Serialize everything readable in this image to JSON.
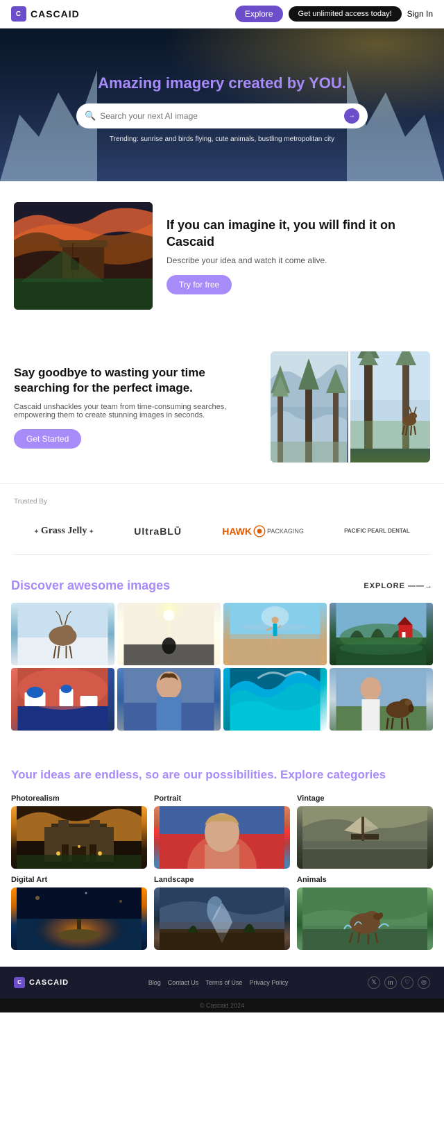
{
  "nav": {
    "logo_text": "CASCAID",
    "explore_btn": "Explore",
    "unlimited_btn": "Get unlimited access today!",
    "signin_btn": "Sign In"
  },
  "hero": {
    "title_plain": "Amazing imagery created by ",
    "title_accent": "YOU.",
    "search_placeholder": "Search your next AI image",
    "trending_label": "Trending:",
    "trending_items": "sunrise and birds flying, cute animals, bustling metropolitan city"
  },
  "section_imagine": {
    "heading": "If you can imagine it, you will find it on Cascaid",
    "description": "Describe your idea and watch it come alive.",
    "cta": "Try for free"
  },
  "section_goodbye": {
    "heading": "Say goodbye to wasting your time searching for the perfect image.",
    "description": "Cascaid unshackles your team from time-consuming searches, empowering them to create stunning images in seconds.",
    "cta": "Get Started"
  },
  "trusted": {
    "label": "Trusted By",
    "brands": [
      {
        "name": "Grass Jelly",
        "style": "script"
      },
      {
        "name": "UltraBLU",
        "style": "bold"
      },
      {
        "name": "HAWK Packaging",
        "style": "orange"
      },
      {
        "name": "Pacific Pearl Dental",
        "style": "small"
      }
    ]
  },
  "discover": {
    "title_plain": "Discover ",
    "title_accent": "awesome",
    "title_suffix": " images",
    "explore_link": "EXPLORE ——→"
  },
  "categories": {
    "title_plain": "Your ideas are endless, so are our possibilities. Explore ",
    "title_accent": "categories",
    "items": [
      {
        "label": "Photorealism",
        "key": "photorealism"
      },
      {
        "label": "Portrait",
        "key": "portrait"
      },
      {
        "label": "Vintage",
        "key": "vintage"
      },
      {
        "label": "Digital Art",
        "key": "digital-art"
      },
      {
        "label": "Landscape",
        "key": "landscape"
      },
      {
        "label": "Animals",
        "key": "animals"
      }
    ]
  },
  "footer": {
    "logo": "CASCAID",
    "links": [
      "Blog",
      "Contact Us",
      "Terms of Use",
      "Privacy Policy"
    ],
    "socials": [
      "𝕏",
      "in",
      "♡",
      "◎"
    ],
    "copyright": "© Cascaid 2024"
  }
}
